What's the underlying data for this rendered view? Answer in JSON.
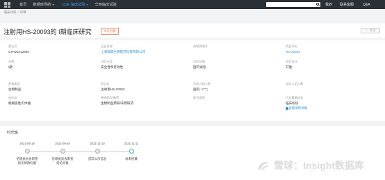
{
  "nav": {
    "items": [
      {
        "label": "首页",
        "active": false,
        "caret": false
      },
      {
        "label": "数据库导航",
        "active": false,
        "caret": true
      },
      {
        "label": "CDE 临床试验",
        "active": true,
        "caret": true
      },
      {
        "label": "华西临床试验",
        "active": false,
        "caret": false
      }
    ],
    "search_placeholder": "",
    "right": [
      "我的",
      "联系客服",
      "Q&A"
    ]
  },
  "breadcrumb": [
    "临床试验",
    "详情"
  ],
  "title": "注射用HS-20093的 I期临床研究",
  "status_badge": "尚未招募",
  "follow_button": "关注",
  "fields": [
    {
      "label": "登记号",
      "value": "CTR20212800",
      "link": false
    },
    {
      "label": "企业名称",
      "value": "上海翰森生物医药科技有限公司",
      "link": true
    },
    {
      "label": "关联受理号",
      "value": "",
      "link": false
    },
    {
      "label": "适应症",
      "value": "",
      "link": false
    },
    {
      "label": "分期",
      "value": "I期",
      "link": false
    },
    {
      "label": "试验分类",
      "value": "安全性和有效性",
      "link": false
    },
    {
      "label": "试验范围",
      "value": "国内试验",
      "link": false
    },
    {
      "label": "实验设计",
      "value": "开放",
      "link": false
    },
    {
      "label": "药物类型",
      "value": "生物制品",
      "link": false
    },
    {
      "label": "药品名",
      "value": "注射用HS-20093",
      "link": false
    },
    {
      "label": "目标入组人数",
      "value": "国内: 177；",
      "link": false
    },
    {
      "label": "实际入组人数",
      "value": "",
      "link": false
    },
    {
      "label": "适应症",
      "value": "晚期恶性实体瘤",
      "link": false
    },
    {
      "label": "原研药/仿制药",
      "value": "生物制品原研/非原研药",
      "link": false
    },
    {
      "label": "联合用药",
      "value": "",
      "link": false
    },
    {
      "label": "产品最高状态",
      "value": "临床阶段",
      "link": false
    }
  ],
  "extra_links": {
    "cde_code": "HS-20093",
    "report": "查看项目详情"
  },
  "timeline": {
    "title": "时光轴",
    "events": [
      {
        "date": "2021-08-19",
        "label": "伦理委员会审查\n结论修改同意",
        "current": false
      },
      {
        "date": "2021-09-29",
        "label": "伦理委员会审查\n结论同意",
        "current": false
      },
      {
        "date": "2021-11-10",
        "label": "首次公示信息",
        "current": false
      },
      {
        "date": "2021-11-11",
        "label": "尚未招募",
        "current": true
      }
    ]
  },
  "watermark": "雪球：Insight数据库"
}
